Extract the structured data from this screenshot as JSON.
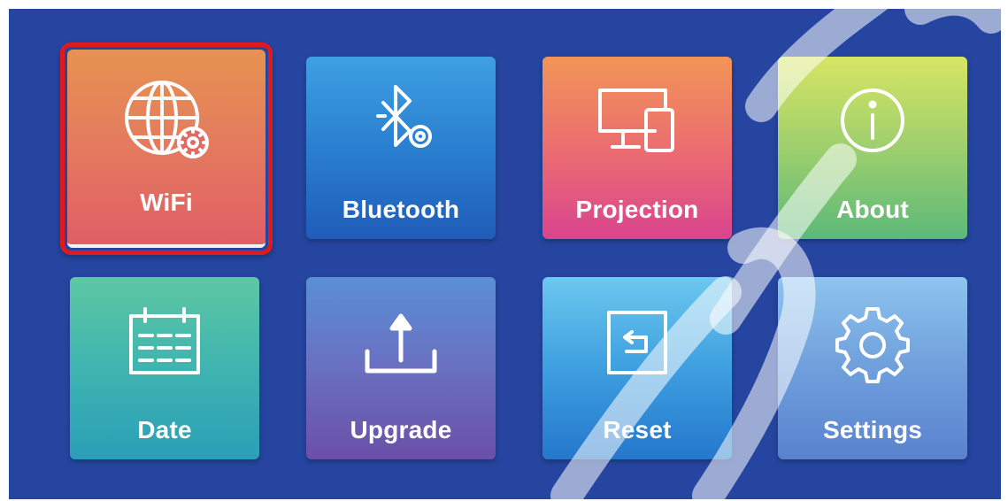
{
  "menu": {
    "tiles": [
      {
        "id": "wifi",
        "label": "WiFi",
        "icon": "globe-gear-icon",
        "selected": true
      },
      {
        "id": "bluetooth",
        "label": "Bluetooth",
        "icon": "bluetooth-gear-icon"
      },
      {
        "id": "projection",
        "label": "Projection",
        "icon": "monitor-tablet-icon"
      },
      {
        "id": "about",
        "label": "About",
        "icon": "info-icon"
      },
      {
        "id": "date",
        "label": "Date",
        "icon": "calendar-icon"
      },
      {
        "id": "upgrade",
        "label": "Upgrade",
        "icon": "upload-icon"
      },
      {
        "id": "reset",
        "label": "Reset",
        "icon": "return-arrow-icon"
      },
      {
        "id": "settings",
        "label": "Settings",
        "icon": "gear-icon"
      }
    ]
  },
  "colors": {
    "background": "#2545a0",
    "selection_border": "#e0191c"
  }
}
